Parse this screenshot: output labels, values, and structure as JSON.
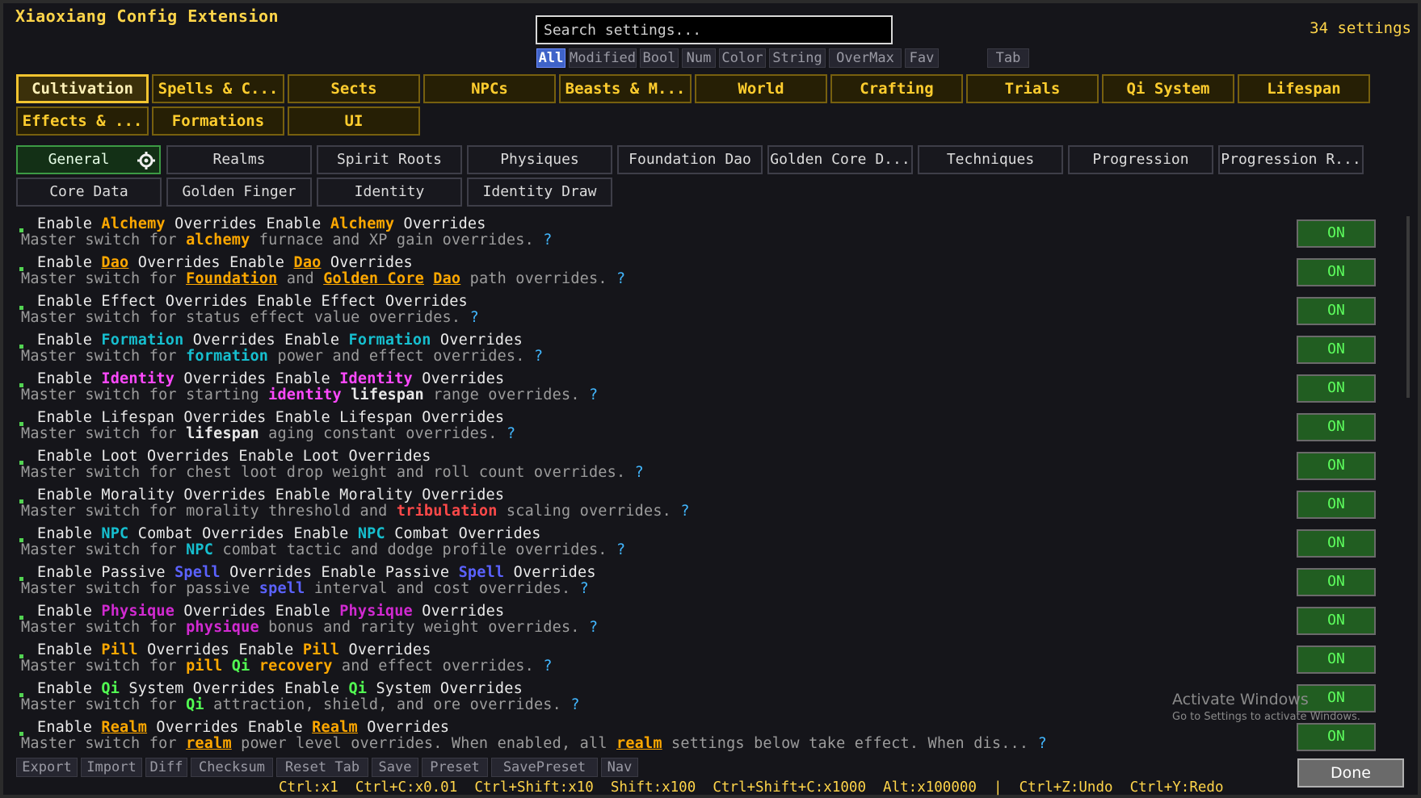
{
  "app": {
    "title": "Xiaoxiang Config Extension",
    "settings_count": "34 settings"
  },
  "search": {
    "placeholder": "Search settings..."
  },
  "filters": [
    "All",
    "Modified",
    "Bool",
    "Num",
    "Color",
    "String",
    "OverMax",
    "Fav",
    "Tab"
  ],
  "active_filter": "All",
  "categories": [
    "Cultivation",
    "Spells & C...",
    "Sects",
    "NPCs",
    "Beasts & M...",
    "World",
    "Crafting",
    "Trials",
    "Qi System",
    "Lifespan",
    "Effects & ...",
    "Formations",
    "UI"
  ],
  "active_category": "Cultivation",
  "subtabs": [
    "General",
    "Realms",
    "Spirit Roots",
    "Physiques",
    "Foundation Dao",
    "Golden Core D...",
    "Techniques",
    "Progression",
    "Progression R...",
    "Core Data",
    "Golden Finger",
    "Identity",
    "Identity Draw"
  ],
  "active_subtab": "General",
  "colors": {
    "gold": "#ffcd2e",
    "orange": "#ffa800",
    "cyan": "#16bfcf",
    "magenta": "#ff49ff",
    "red": "#ff4949",
    "blue": "#5b62ff",
    "purple": "#d12ad1",
    "green": "#52ff52",
    "toggle_on_bg": "#215d21",
    "toggle_on_text": "#5dff5d"
  },
  "settings": [
    {
      "title": [
        [
          "Enable "
        ],
        [
          "Alchemy",
          "orange"
        ],
        [
          " Overrides Enable "
        ],
        [
          "Alchemy",
          "orange"
        ],
        [
          " Overrides"
        ]
      ],
      "desc": [
        [
          "Master switch for "
        ],
        [
          "alchemy",
          "orange"
        ],
        [
          " furnace and XP gain overrides. "
        ]
      ],
      "value": "ON"
    },
    {
      "title": [
        [
          "Enable "
        ],
        [
          "Dao",
          "orange",
          true
        ],
        [
          " Overrides Enable "
        ],
        [
          "Dao",
          "orange",
          true
        ],
        [
          " Overrides"
        ]
      ],
      "desc": [
        [
          "Master switch for "
        ],
        [
          "Foundation",
          "orange",
          true
        ],
        [
          " and "
        ],
        [
          "Golden Core",
          "orange",
          true
        ],
        [
          " "
        ],
        [
          "Dao",
          "orange",
          true
        ],
        [
          " path overrides. "
        ]
      ],
      "value": "ON"
    },
    {
      "title": [
        [
          "Enable Effect Overrides Enable Effect Overrides"
        ]
      ],
      "desc": [
        [
          "Master switch for status effect value overrides. "
        ]
      ],
      "value": "ON"
    },
    {
      "title": [
        [
          "Enable "
        ],
        [
          "Formation",
          "cyan"
        ],
        [
          " Overrides Enable "
        ],
        [
          "Formation",
          "cyan"
        ],
        [
          " Overrides"
        ]
      ],
      "desc": [
        [
          "Master switch for "
        ],
        [
          "formation",
          "cyan"
        ],
        [
          " power and effect overrides. "
        ]
      ],
      "value": "ON"
    },
    {
      "title": [
        [
          "Enable "
        ],
        [
          "Identity",
          "magenta"
        ],
        [
          " Overrides Enable "
        ],
        [
          "Identity",
          "magenta"
        ],
        [
          " Overrides"
        ]
      ],
      "desc": [
        [
          "Master switch for starting "
        ],
        [
          "identity",
          "magenta"
        ],
        [
          " "
        ],
        [
          "lifespan",
          "plain"
        ],
        [
          " range overrides. "
        ]
      ],
      "value": "ON"
    },
    {
      "title": [
        [
          "Enable Lifespan Overrides Enable Lifespan Overrides"
        ]
      ],
      "desc": [
        [
          "Master switch for "
        ],
        [
          "lifespan",
          "plain"
        ],
        [
          " aging constant overrides. "
        ]
      ],
      "value": "ON"
    },
    {
      "title": [
        [
          "Enable Loot Overrides Enable Loot Overrides"
        ]
      ],
      "desc": [
        [
          "Master switch for chest loot drop weight and roll count overrides. "
        ]
      ],
      "value": "ON"
    },
    {
      "title": [
        [
          "Enable Morality Overrides Enable Morality Overrides"
        ]
      ],
      "desc": [
        [
          "Master switch for morality threshold and "
        ],
        [
          "tribulation",
          "red"
        ],
        [
          " scaling overrides. "
        ]
      ],
      "value": "ON"
    },
    {
      "title": [
        [
          "Enable "
        ],
        [
          "NPC",
          "cyan"
        ],
        [
          " Combat Overrides Enable "
        ],
        [
          "NPC",
          "cyan"
        ],
        [
          " Combat Overrides"
        ]
      ],
      "desc": [
        [
          "Master switch for "
        ],
        [
          "NPC",
          "cyan"
        ],
        [
          " combat tactic and dodge profile overrides. "
        ]
      ],
      "value": "ON"
    },
    {
      "title": [
        [
          "Enable Passive "
        ],
        [
          "Spell",
          "blue"
        ],
        [
          " Overrides Enable Passive "
        ],
        [
          "Spell",
          "blue"
        ],
        [
          " Overrides"
        ]
      ],
      "desc": [
        [
          "Master switch for passive "
        ],
        [
          "spell",
          "blue"
        ],
        [
          " interval and cost overrides. "
        ]
      ],
      "value": "ON"
    },
    {
      "title": [
        [
          "Enable "
        ],
        [
          "Physique",
          "purple"
        ],
        [
          " Overrides Enable "
        ],
        [
          "Physique",
          "purple"
        ],
        [
          " Overrides"
        ]
      ],
      "desc": [
        [
          "Master switch for "
        ],
        [
          "physique",
          "purple"
        ],
        [
          " bonus and rarity weight overrides. "
        ]
      ],
      "value": "ON"
    },
    {
      "title": [
        [
          "Enable "
        ],
        [
          "Pill",
          "orange"
        ],
        [
          " Overrides Enable "
        ],
        [
          "Pill",
          "orange"
        ],
        [
          " Overrides"
        ]
      ],
      "desc": [
        [
          "Master switch for "
        ],
        [
          "pill",
          "orange"
        ],
        [
          " "
        ],
        [
          "Qi",
          "green"
        ],
        [
          " "
        ],
        [
          "recovery",
          "orange"
        ],
        [
          " and effect overrides. "
        ]
      ],
      "value": "ON"
    },
    {
      "title": [
        [
          "Enable "
        ],
        [
          "Qi",
          "green"
        ],
        [
          " System Overrides Enable "
        ],
        [
          "Qi",
          "green"
        ],
        [
          " System Overrides"
        ]
      ],
      "desc": [
        [
          "Master switch for "
        ],
        [
          "Qi",
          "green"
        ],
        [
          " attraction, shield, and ore overrides. "
        ]
      ],
      "value": "ON"
    },
    {
      "title": [
        [
          "Enable "
        ],
        [
          "Realm",
          "orange",
          true
        ],
        [
          " Overrides Enable "
        ],
        [
          "Realm",
          "orange",
          true
        ],
        [
          " Overrides"
        ]
      ],
      "desc": [
        [
          "Master switch for "
        ],
        [
          "realm",
          "orange",
          true
        ],
        [
          " power level overrides. When enabled, all "
        ],
        [
          "realm",
          "orange",
          true
        ],
        [
          " settings below take effect. When dis... "
        ]
      ],
      "value": "ON"
    }
  ],
  "help_mark": "?",
  "toolbar": [
    "Export",
    "Import",
    "Diff",
    "Checksum",
    "Reset Tab",
    "Save",
    "Preset",
    "SavePreset",
    "Nav"
  ],
  "done_label": "Done",
  "shortcuts": "Ctrl:x1  Ctrl+C:x0.01  Ctrl+Shift:x10  Shift:x100  Ctrl+Shift+C:x1000  Alt:x100000  |  Ctrl+Z:Undo  Ctrl+Y:Redo",
  "watermark": {
    "line1": "Activate Windows",
    "line2": "Go to Settings to activate Windows."
  }
}
